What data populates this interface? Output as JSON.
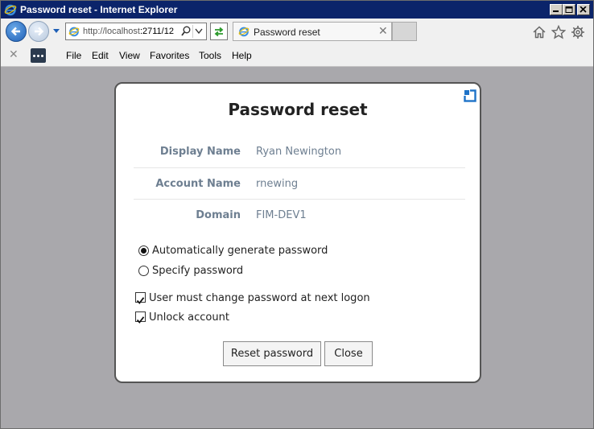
{
  "window": {
    "title": "Password reset - Internet Explorer"
  },
  "browser": {
    "url_host": "http://localhost",
    "url_rest": ":2711/12",
    "tab_label": "Password reset",
    "menu": [
      "File",
      "Edit",
      "View",
      "Favorites",
      "Tools",
      "Help"
    ]
  },
  "dialog": {
    "title": "Password reset",
    "fields": [
      {
        "label": "Display Name",
        "value": "Ryan Newington"
      },
      {
        "label": "Account Name",
        "value": "rnewing"
      },
      {
        "label": "Domain",
        "value": "FIM-DEV1"
      }
    ],
    "password_options": [
      {
        "label": "Automatically generate password",
        "selected": true
      },
      {
        "label": "Specify password",
        "selected": false
      }
    ],
    "checkboxes": [
      {
        "label": "User must change password at next logon",
        "checked": true
      },
      {
        "label": "Unlock account",
        "checked": true
      }
    ],
    "buttons": {
      "reset": "Reset password",
      "close": "Close"
    }
  },
  "colors": {
    "titlebar": "#0b246a",
    "page_background": "#a9a8ac",
    "label_text": "#6e7f91",
    "popout_icon": "#1e73c8"
  }
}
